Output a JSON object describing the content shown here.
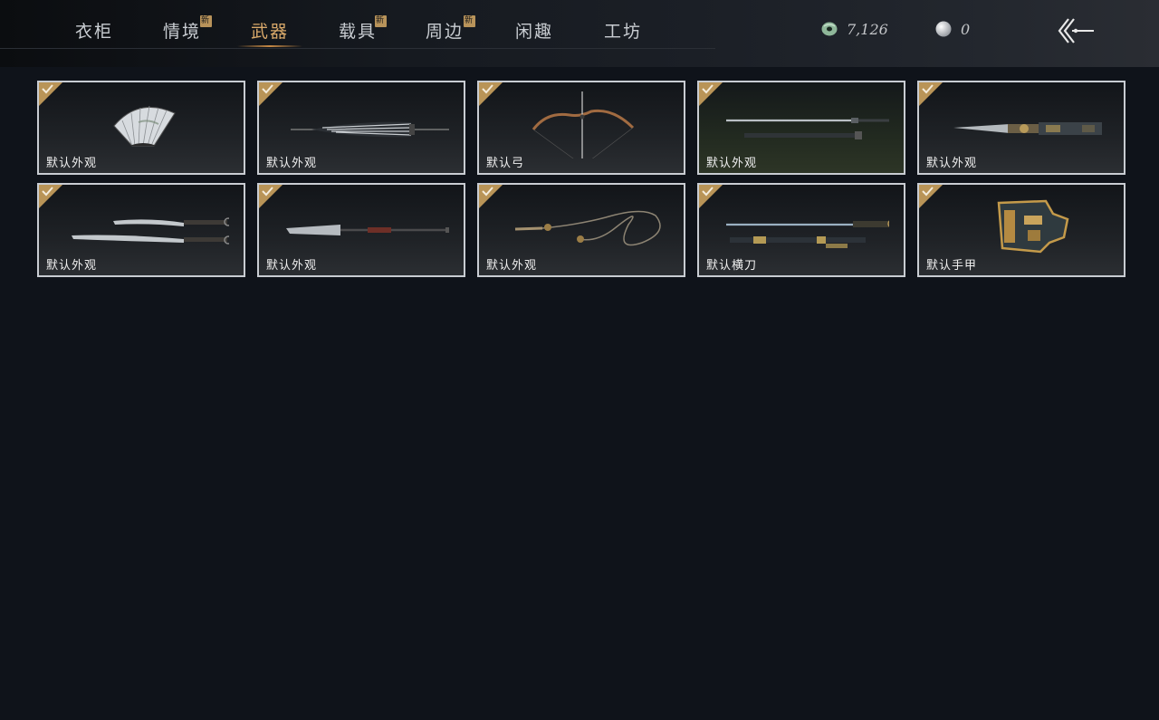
{
  "nav": {
    "tabs": [
      {
        "label": "衣柜",
        "badge": ""
      },
      {
        "label": "情境",
        "badge": "新"
      },
      {
        "label": "武器",
        "badge": ""
      },
      {
        "label": "载具",
        "badge": "新"
      },
      {
        "label": "周边",
        "badge": "新"
      },
      {
        "label": "闲趣",
        "badge": ""
      },
      {
        "label": "工坊",
        "badge": ""
      }
    ],
    "active_tab": "武器"
  },
  "currency": {
    "jade": {
      "value": "7,126",
      "icon": "jade-coin-icon"
    },
    "pearl": {
      "value": "0",
      "icon": "pearl-icon"
    }
  },
  "back": {
    "icon": "back-arrow-icon"
  },
  "colors": {
    "accent": "#d9a96a",
    "check": "#b99457",
    "card_border": "#c8ccd2",
    "background": "#0f131a"
  },
  "weapons": [
    {
      "label": "默认外观",
      "art": "fan-icon",
      "owned": true
    },
    {
      "label": "默认外观",
      "art": "umbrella-icon",
      "owned": true
    },
    {
      "label": "默认弓",
      "art": "bow-icon",
      "owned": true
    },
    {
      "label": "默认外观",
      "art": "sword-icon",
      "owned": true
    },
    {
      "label": "默认外观",
      "art": "ornate-blade-icon",
      "owned": true
    },
    {
      "label": "默认外观",
      "art": "twin-sabres-icon",
      "owned": true
    },
    {
      "label": "默认外观",
      "art": "glaive-icon",
      "owned": true
    },
    {
      "label": "默认外观",
      "art": "rope-dart-icon",
      "owned": true
    },
    {
      "label": "默认横刀",
      "art": "hengdao-icon",
      "owned": true
    },
    {
      "label": "默认手甲",
      "art": "gauntlet-icon",
      "owned": true
    }
  ]
}
